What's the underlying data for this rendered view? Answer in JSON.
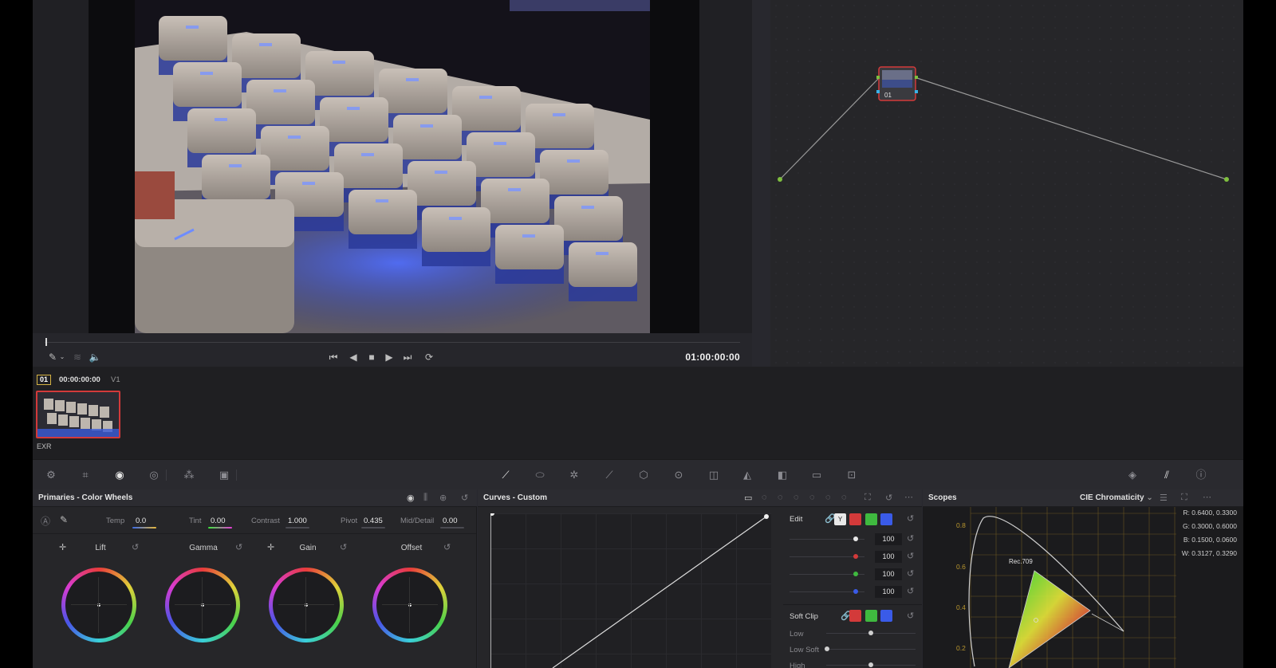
{
  "viewer": {
    "timecode": "01:00:00:00",
    "playhead_fraction": 0.0
  },
  "node_editor": {
    "node_label": "01"
  },
  "clip_strip": {
    "clip_number": "01",
    "clip_timecode": "00:00:00:00",
    "track": "V1",
    "codec": "EXR"
  },
  "primaries": {
    "title": "Primaries - Color Wheels",
    "params": [
      {
        "label": "Temp",
        "value": "0.0"
      },
      {
        "label": "Tint",
        "value": "0.00"
      },
      {
        "label": "Contrast",
        "value": "1.000"
      },
      {
        "label": "Pivot",
        "value": "0.435"
      },
      {
        "label": "Mid/Detail",
        "value": "0.00"
      }
    ],
    "wheels": [
      {
        "label": "Lift"
      },
      {
        "label": "Gamma"
      },
      {
        "label": "Gain"
      },
      {
        "label": "Offset"
      }
    ]
  },
  "curves": {
    "title": "Curves - Custom",
    "edit_label": "Edit",
    "channel_values": [
      "100",
      "100",
      "100",
      "100"
    ],
    "y_button": "Y",
    "soft_clip": {
      "label": "Soft Clip",
      "rows": [
        "Low",
        "Low Soft",
        "High"
      ]
    }
  },
  "scopes": {
    "title": "Scopes",
    "mode": "CIE Chromaticity",
    "readouts": [
      "R: 0.6400, 0.3300",
      "G: 0.3000, 0.6000",
      "B: 0.1500, 0.0600",
      "W: 0.3127, 0.3290"
    ],
    "y_ticks": [
      "0.8",
      "0.6",
      "0.4",
      "0.2"
    ],
    "gamut_label": "Rec.709"
  },
  "colors": {
    "accent_red": "#d33a3a",
    "accent_green": "#3fb93f",
    "accent_blue": "#3a5be8",
    "selection_gold": "#d6b343"
  }
}
